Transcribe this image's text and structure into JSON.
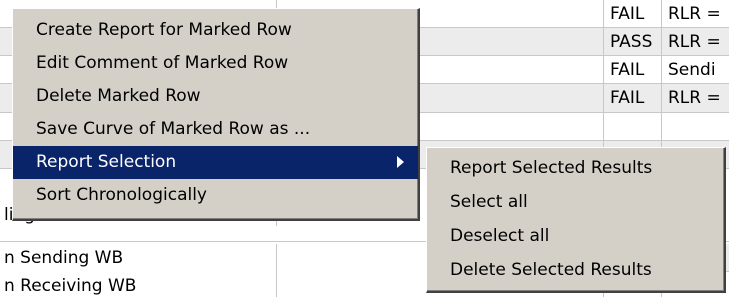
{
  "table": {
    "rows": [
      {
        "c1": "",
        "c2": "",
        "result": "FAIL",
        "comment": "RLR ="
      },
      {
        "c1": "",
        "c2": "",
        "result": "PASS",
        "comment": "RLR ="
      },
      {
        "c1": "",
        "c2": "",
        "result": "FAIL",
        "comment": "Sendi"
      },
      {
        "c1": "",
        "c2": "",
        "result": "FAIL",
        "comment": "RLR ="
      },
      {
        "c1": "",
        "c2": "",
        "result": "",
        "comment": ""
      },
      {
        "c1": "",
        "c2": "",
        "result": "",
        "comment": ""
      },
      {
        "c1": "ling WB",
        "c2": "",
        "result": "",
        "comment": ""
      },
      {
        "c1": "n Sending WB",
        "c2": "",
        "result": "",
        "comment": ""
      },
      {
        "c1": "n Receiving WB",
        "c2": "",
        "result": "",
        "comment": ""
      }
    ]
  },
  "context_menu": {
    "items": [
      {
        "label": "Create Report for Marked Row"
      },
      {
        "label": "Edit Comment of Marked Row"
      },
      {
        "label": "Delete Marked Row"
      },
      {
        "label": "Save Curve of Marked Row as ..."
      },
      {
        "label": "Report Selection",
        "selected": true,
        "submenu": true
      },
      {
        "label": "Sort Chronologically"
      }
    ]
  },
  "submenu": {
    "items": [
      {
        "label": "Report Selected Results"
      },
      {
        "label": "Select all"
      },
      {
        "label": "Deselect all"
      },
      {
        "label": "Delete Selected Results"
      }
    ]
  },
  "colors": {
    "menu_bg": "#d4d0c8",
    "highlight_bg": "#0a246a",
    "highlight_text": "#ffffff"
  }
}
